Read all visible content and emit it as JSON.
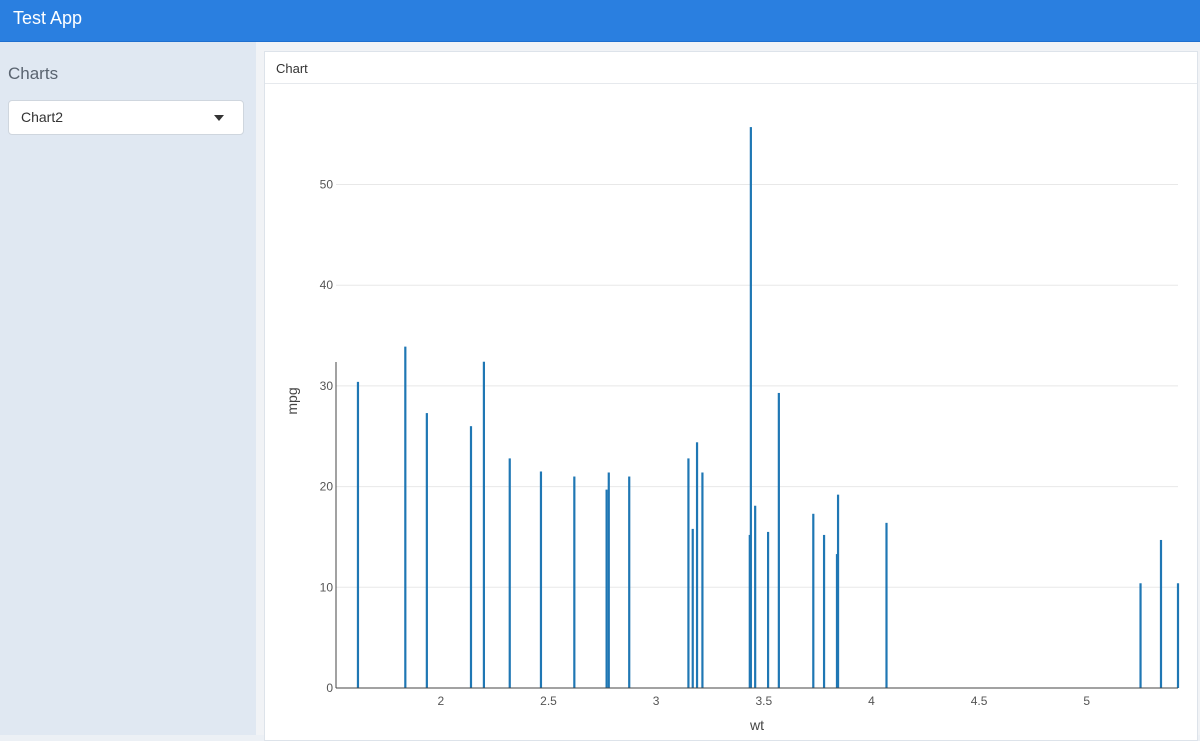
{
  "app": {
    "title": "Test App"
  },
  "sidebar": {
    "heading": "Charts",
    "select": {
      "value": "Chart2",
      "icon": "caret-down-icon"
    }
  },
  "panel": {
    "title": "Chart"
  },
  "colors": {
    "navbar": "#2a7fe0",
    "bar": "#1f77b4",
    "sidebar": "#e0e8f2"
  },
  "chart_data": {
    "type": "bar",
    "xlabel": "wt",
    "ylabel": "mpg",
    "xlim": [
      1.513,
      5.424
    ],
    "ylim": [
      0,
      57
    ],
    "xticks": [
      2,
      2.5,
      3,
      3.5,
      4,
      4.5,
      5
    ],
    "yticks": [
      0,
      10,
      20,
      30,
      40,
      50
    ],
    "grid": "horizontal",
    "points": [
      {
        "x": 1.615,
        "y": 30.4
      },
      {
        "x": 1.835,
        "y": 33.9
      },
      {
        "x": 1.935,
        "y": 27.3
      },
      {
        "x": 2.14,
        "y": 26.0
      },
      {
        "x": 2.2,
        "y": 32.4
      },
      {
        "x": 2.32,
        "y": 22.8
      },
      {
        "x": 2.465,
        "y": 21.5
      },
      {
        "x": 2.62,
        "y": 21.0
      },
      {
        "x": 2.77,
        "y": 19.7
      },
      {
        "x": 2.78,
        "y": 21.4
      },
      {
        "x": 2.875,
        "y": 21.0
      },
      {
        "x": 3.15,
        "y": 22.8
      },
      {
        "x": 3.17,
        "y": 15.8
      },
      {
        "x": 3.19,
        "y": 24.4
      },
      {
        "x": 3.215,
        "y": 21.4
      },
      {
        "x": 3.435,
        "y": 15.2
      },
      {
        "x": 3.44,
        "y": 55.7
      },
      {
        "x": 3.46,
        "y": 18.1
      },
      {
        "x": 3.52,
        "y": 15.5
      },
      {
        "x": 3.57,
        "y": 29.3
      },
      {
        "x": 3.73,
        "y": 17.3
      },
      {
        "x": 3.78,
        "y": 15.2
      },
      {
        "x": 3.84,
        "y": 13.3
      },
      {
        "x": 3.845,
        "y": 19.2
      },
      {
        "x": 4.07,
        "y": 16.4
      },
      {
        "x": 5.25,
        "y": 10.4
      },
      {
        "x": 5.345,
        "y": 14.7
      },
      {
        "x": 5.424,
        "y": 10.4
      }
    ]
  }
}
